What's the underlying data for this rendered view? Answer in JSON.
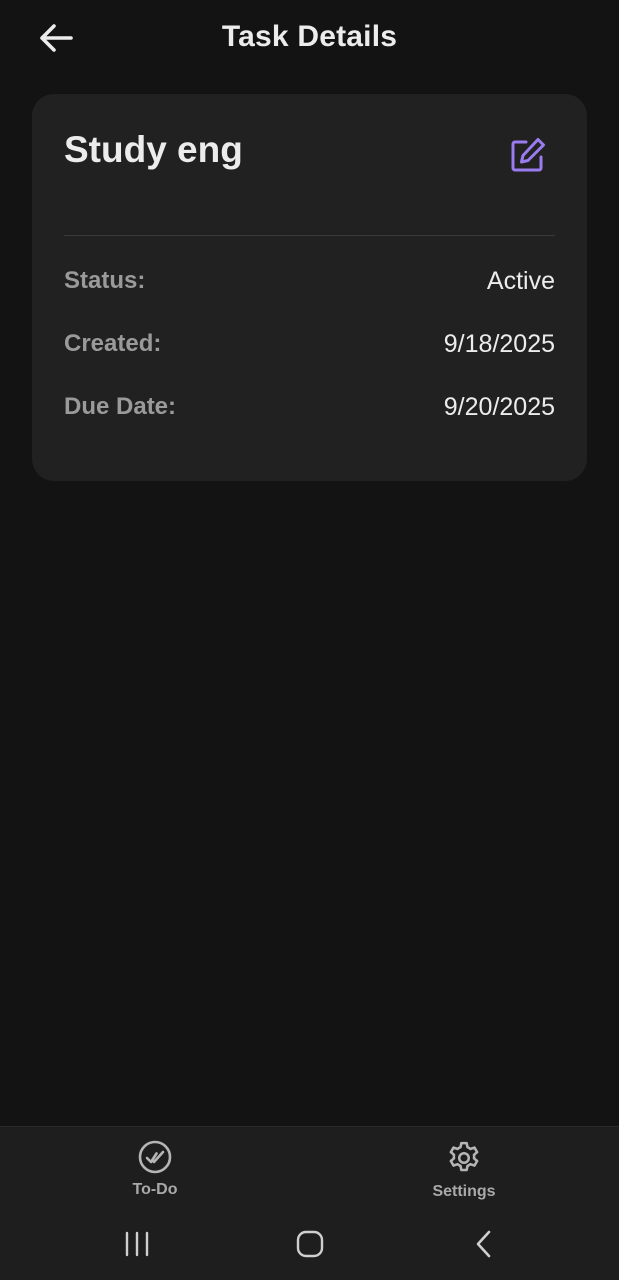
{
  "header": {
    "title": "Task Details",
    "back_icon": "arrow-left-icon"
  },
  "task": {
    "title": "Study eng",
    "edit_icon": "edit-square-icon",
    "accent_color": "#9b7cf0",
    "details": [
      {
        "label": "Status:",
        "value": "Active"
      },
      {
        "label": "Created:",
        "value": "9/18/2025"
      },
      {
        "label": "Due Date:",
        "value": "9/20/2025"
      }
    ]
  },
  "bottom_nav": {
    "items": [
      {
        "label": "To-Do",
        "icon": "check-circle-icon"
      },
      {
        "label": "Settings",
        "icon": "gear-icon"
      }
    ]
  },
  "system_nav": {
    "recents_icon": "recents-icon",
    "home_icon": "home-icon",
    "back_icon": "system-back-icon"
  }
}
